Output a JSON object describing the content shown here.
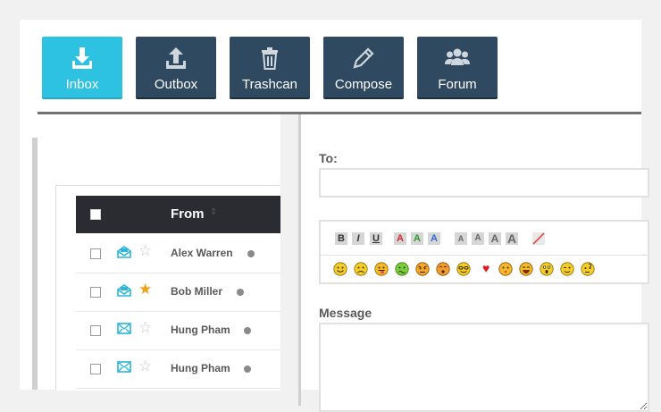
{
  "toolbar": {
    "inbox": "Inbox",
    "outbox": "Outbox",
    "trashcan": "Trashcan",
    "compose": "Compose",
    "forum": "Forum"
  },
  "table": {
    "from_header": "From",
    "rows": [
      {
        "name": "Alex Warren",
        "starred": false,
        "read": true
      },
      {
        "name": "Bob Miller",
        "starred": true,
        "read": true
      },
      {
        "name": "Hung Pham",
        "starred": false,
        "read": false
      },
      {
        "name": "Hung Pham",
        "starred": false,
        "read": false
      }
    ]
  },
  "compose": {
    "to_label": "To:",
    "to_value": "",
    "message_label": "Message",
    "message_value": "",
    "format_buttons": [
      "B",
      "I",
      "U",
      "A",
      "A",
      "A",
      "A",
      "A",
      "A",
      "A"
    ],
    "emoticons": [
      "smile",
      "sad",
      "tongue",
      "sick",
      "angry",
      "surprised",
      "cool",
      "heart",
      "kiss",
      "laugh",
      "shocked",
      "wink",
      "confused"
    ]
  },
  "colors": {
    "active": "#2ec2e2",
    "button": "#2f4a60",
    "header_dark": "#2a2c31",
    "star_on": "#f0a015",
    "envelope": "#2ab6d9"
  }
}
